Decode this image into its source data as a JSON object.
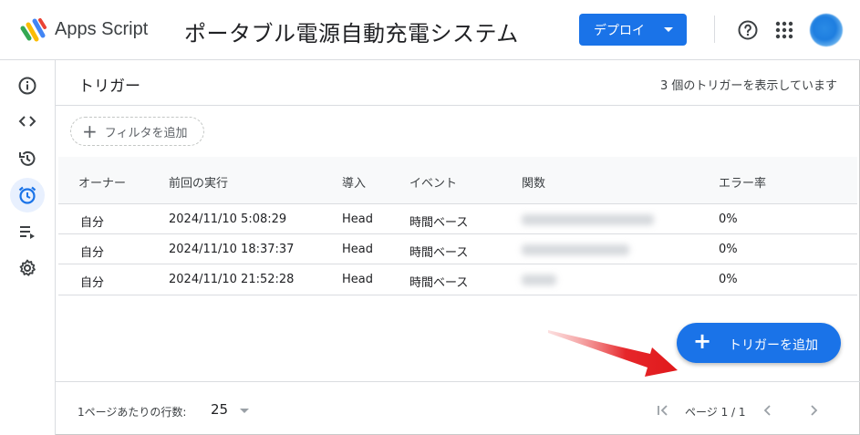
{
  "header": {
    "app_name": "Apps Script",
    "project_title": "ポータブル電源自動充電システム",
    "deploy_label": "デプロイ"
  },
  "sidebar": {
    "items": [
      {
        "icon": "info-icon",
        "active": false
      },
      {
        "icon": "code-icon",
        "active": false
      },
      {
        "icon": "history-icon",
        "active": false
      },
      {
        "icon": "alarm-clock-icon",
        "active": true
      },
      {
        "icon": "executions-icon",
        "active": false
      },
      {
        "icon": "gear-icon",
        "active": false
      }
    ]
  },
  "main": {
    "title": "トリガー",
    "trigger_count": "3 個のトリガーを表示しています",
    "filter_label": "フィルタを追加",
    "add_trigger_label": "トリガーを追加"
  },
  "table": {
    "columns": [
      "オーナー",
      "前回の実行",
      "導入",
      "イベント",
      "関数",
      "エラー率"
    ],
    "rows": [
      {
        "owner": "自分",
        "last_run": "2024/11/10 5:08:29",
        "deployment": "Head",
        "event": "時間ベース",
        "function": "",
        "error_rate": "0%"
      },
      {
        "owner": "自分",
        "last_run": "2024/11/10 18:37:37",
        "deployment": "Head",
        "event": "時間ベース",
        "function": "",
        "error_rate": "0%"
      },
      {
        "owner": "自分",
        "last_run": "2024/11/10 21:52:28",
        "deployment": "Head",
        "event": "時間ベース",
        "function": "",
        "error_rate": "0%"
      }
    ]
  },
  "footer": {
    "rows_per_page_label": "1ページあたりの行数:",
    "rows_per_page_value": "25",
    "page_info": "ページ 1 / 1"
  },
  "colors": {
    "accent": "#1a73e8",
    "sidebar_active_bg": "#e8f0fe",
    "arrow": "#e0191b"
  }
}
